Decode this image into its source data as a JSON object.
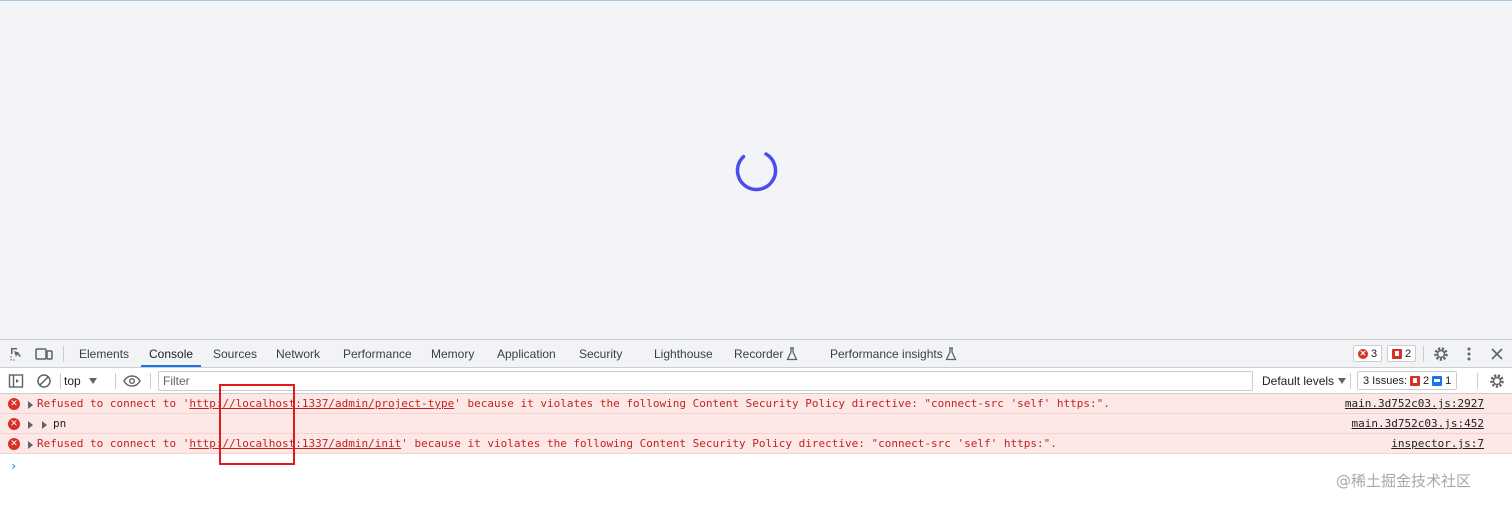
{
  "tabs": [
    "Elements",
    "Console",
    "Sources",
    "Network",
    "Performance",
    "Memory",
    "Application",
    "Security",
    "Lighthouse",
    "Recorder",
    "Performance insights"
  ],
  "active_tab": "Console",
  "badges": {
    "errors": "3",
    "warnings": "2"
  },
  "toolbar": {
    "context": "top",
    "filter_placeholder": "Filter",
    "levels": "Default levels",
    "issues_label": "3 Issues:",
    "issues_errors": "2",
    "issues_info": "1"
  },
  "messages": [
    {
      "prefix": "Refused to connect to '",
      "url": "http://localhost:1337/admin/project-type",
      "suffix": "' because it violates the following Content Security Policy directive: \"connect-src 'self' https:\".",
      "source": "main.3d752c03.js:2927"
    },
    {
      "text": "pn",
      "source": "main.3d752c03.js:452"
    },
    {
      "prefix": "Refused to connect to '",
      "url": "http://localhost:1337/admin/init",
      "suffix": "' because it violates the following Content Security Policy directive: \"connect-src 'self' https:\".",
      "source": "inspector.js:7"
    }
  ],
  "prompt": "›",
  "watermark": "@稀土掘金技术社区",
  "colors": {
    "accent": "#1a73e8",
    "error": "#d93025",
    "error_bg": "#fce8e6",
    "spinner": "#4a4cf0",
    "highlight": "#e01a1a"
  },
  "icons": [
    "inspect-element-icon",
    "device-toolbar-icon",
    "flask-icon",
    "gear-icon",
    "kebab-menu-icon",
    "close-icon",
    "sidebar-toggle-icon",
    "clear-console-icon",
    "eye-icon",
    "error-icon",
    "expand-triangle-icon"
  ]
}
